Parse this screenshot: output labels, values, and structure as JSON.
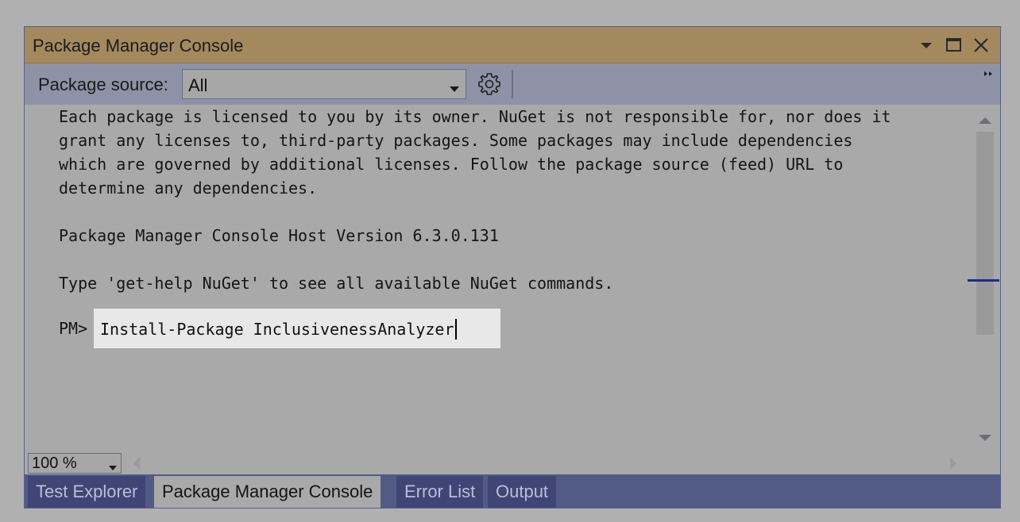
{
  "window": {
    "title": "Package Manager Console",
    "icons": [
      "window-position-dropdown-icon",
      "maximize-icon",
      "close-icon"
    ]
  },
  "toolbar": {
    "source_label": "Package source:",
    "source_value": "All",
    "settings_icon": "gear-icon",
    "overflow_icon": "toolbar-overflow-icon"
  },
  "console": {
    "lines": [
      "Each package is licensed to you by its owner. NuGet is not responsible for, nor does it",
      "grant any licenses to, third-party packages. Some packages may include dependencies",
      "which are governed by additional licenses. Follow the package source (feed) URL to",
      "determine any dependencies.",
      "",
      "Package Manager Console Host Version 6.3.0.131",
      "",
      "Type 'get-help NuGet' to see all available NuGet commands."
    ],
    "prompt": "PM>",
    "command": "Install-Package InclusivenessAnalyzer"
  },
  "bottom": {
    "zoom": "100 %"
  },
  "tabs": [
    {
      "label": "Test Explorer",
      "active": false
    },
    {
      "label": "Package Manager Console",
      "active": true
    },
    {
      "label": "Error List",
      "active": false
    },
    {
      "label": "Output",
      "active": false
    }
  ],
  "colors": {
    "titlebar": "#a4895f",
    "toolbar": "#8e92a6",
    "console_bg": "#a9a9a9",
    "tab_strip": "#525a86",
    "scroll_marker": "#1f2a8c"
  }
}
